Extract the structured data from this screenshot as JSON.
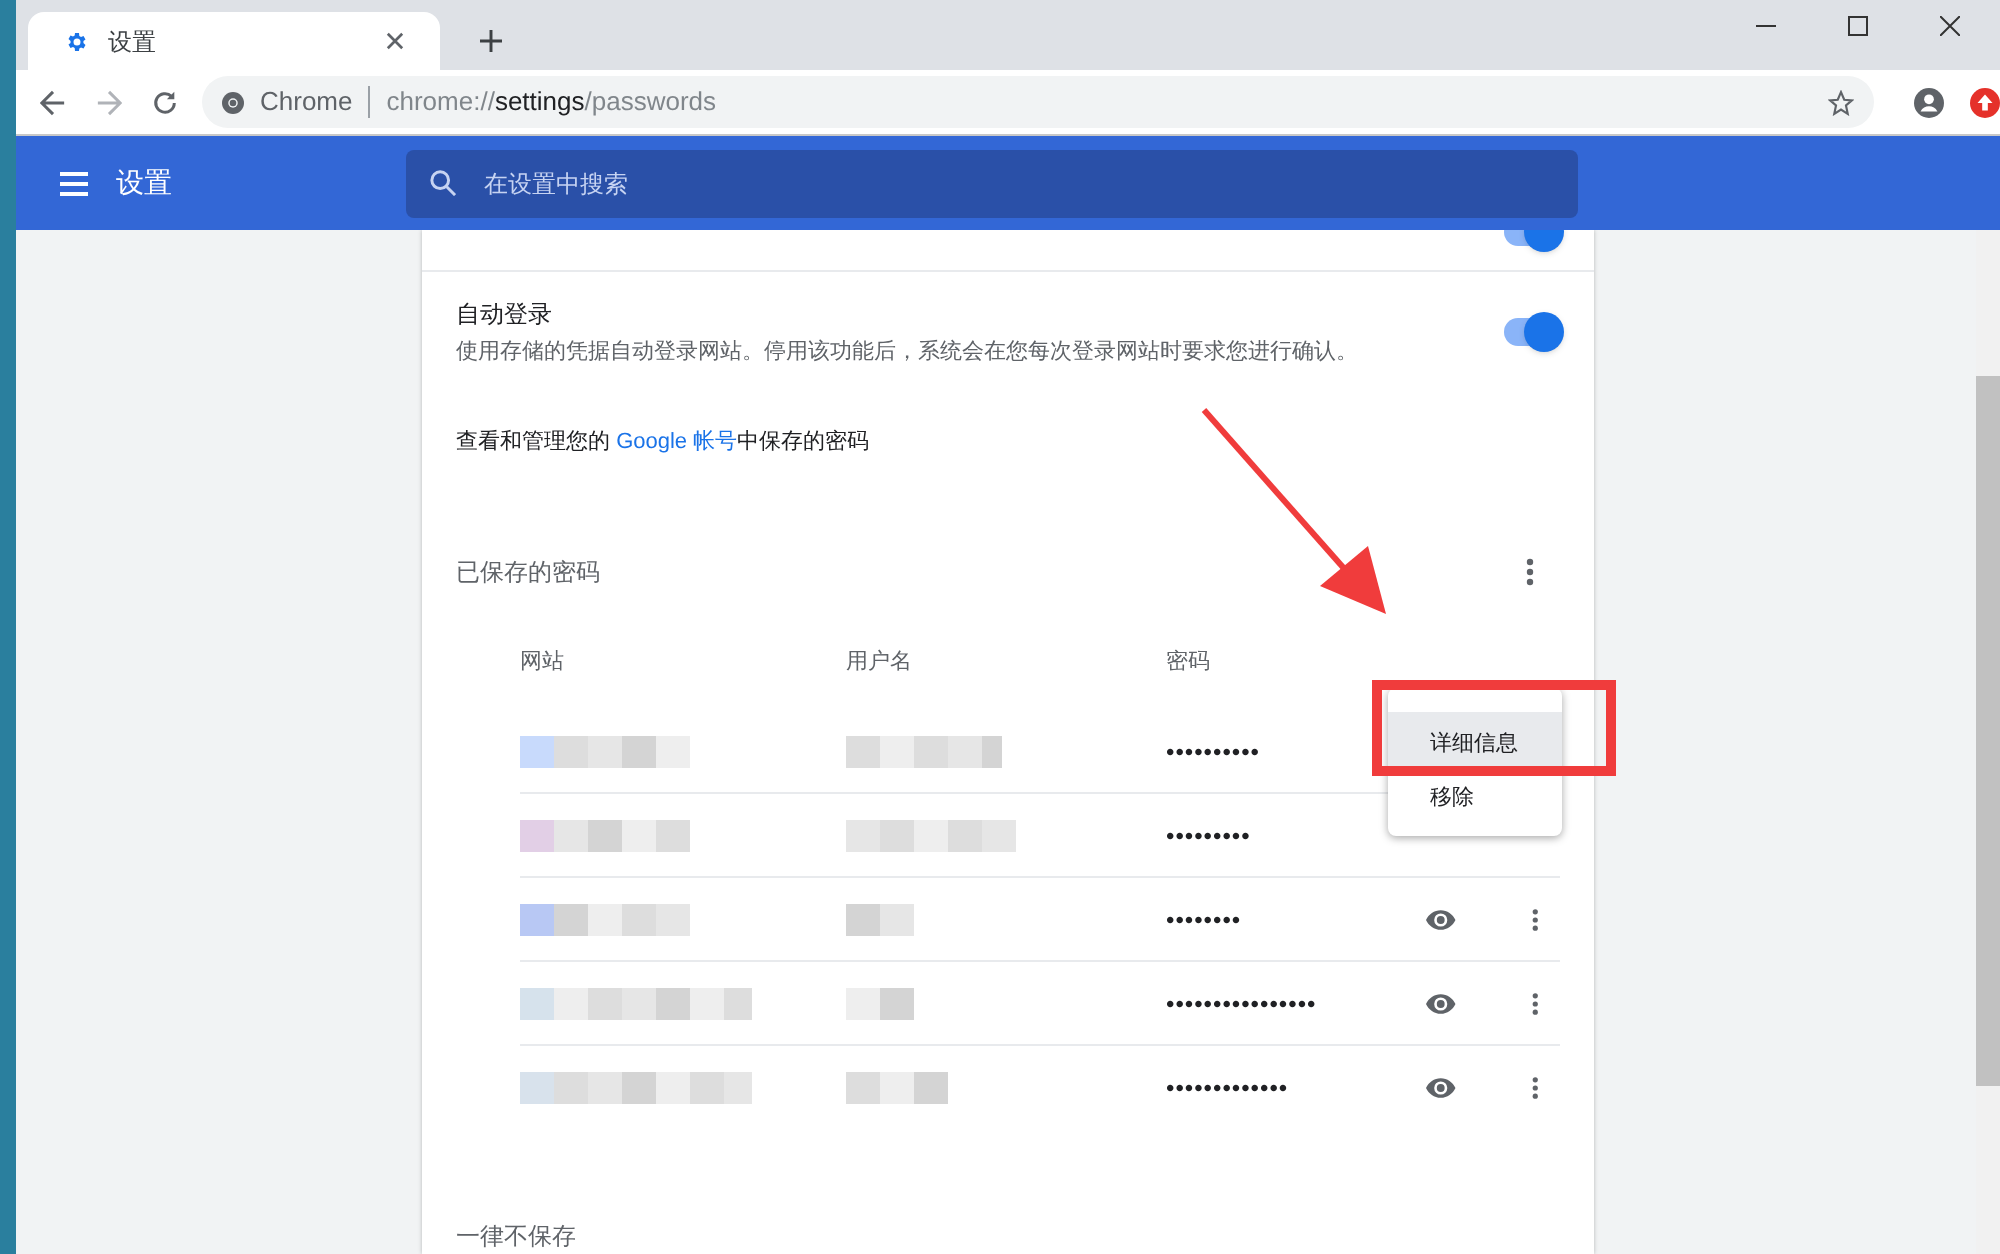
{
  "tab": {
    "title": "设置",
    "selected": true
  },
  "address": {
    "origin": "Chrome",
    "scheme": "chrome://",
    "host": "settings",
    "path": "/passwords"
  },
  "header": {
    "title": "设置",
    "search_placeholder": "在设置中搜索"
  },
  "partial_toggle": {
    "on": true
  },
  "auto_signin": {
    "label": "自动登录",
    "description": "使用存储的凭据自动登录网站。停用该功能后，系统会在您每次登录网站时要求您进行确认。",
    "on": true
  },
  "account_line": {
    "before": "查看和管理您的 ",
    "link": "Google 帐号",
    "after": "中保存的密码"
  },
  "saved": {
    "title": "已保存的密码",
    "columns": [
      "网站",
      "用户名",
      "密码"
    ],
    "rows": [
      {
        "password": "••••••••••",
        "menu_open": true
      },
      {
        "password": "•••••••••",
        "menu_open": false
      },
      {
        "password": "••••••••",
        "menu_open": false
      },
      {
        "password": "••••••••••••••••",
        "menu_open": false
      },
      {
        "password": "•••••••••••••",
        "menu_open": false
      }
    ],
    "menu": [
      {
        "label": "详细信息",
        "selected": true
      },
      {
        "label": "移除",
        "selected": false
      }
    ]
  },
  "never_saved": {
    "title": "一律不保存"
  }
}
